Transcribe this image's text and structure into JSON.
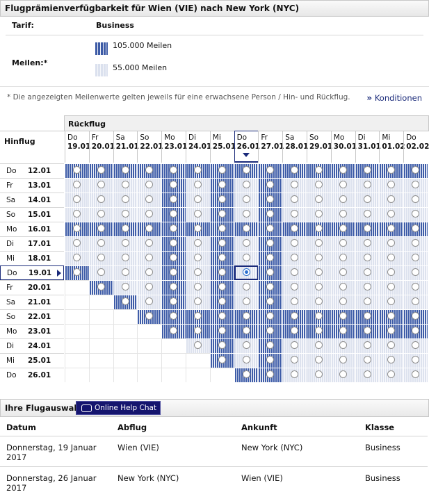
{
  "header": {
    "title": "Flugprämienverfügbarkeit für Wien (VIE) nach New York (NYC)"
  },
  "info": {
    "tarif_label": "Tarif:",
    "tarif_value": "Business",
    "meilen_label": "Meilen:*",
    "legend": [
      {
        "label": "105.000 Meilen",
        "color": "#3f5da8"
      },
      {
        "label": "55.000 Meilen",
        "color": "#dde2ee"
      }
    ],
    "note": "* Die angezeigten Meilenwerte gelten jeweils für eine erwachsene Person / Hin- und Rückflug.",
    "konditionen_arrow": "»",
    "konditionen": "Konditionen"
  },
  "calendar": {
    "rueckflug_label": "Rückflug",
    "hinflug_label": "Hinflug",
    "columns": [
      {
        "day": "Do",
        "date": "19.01"
      },
      {
        "day": "Fr",
        "date": "20.01"
      },
      {
        "day": "Sa",
        "date": "21.01"
      },
      {
        "day": "So",
        "date": "22.01"
      },
      {
        "day": "Mo",
        "date": "23.01"
      },
      {
        "day": "Di",
        "date": "24.01"
      },
      {
        "day": "Mi",
        "date": "25.01"
      },
      {
        "day": "Do",
        "date": "26.01"
      },
      {
        "day": "Fr",
        "date": "27.01"
      },
      {
        "day": "Sa",
        "date": "28.01"
      },
      {
        "day": "So",
        "date": "29.01"
      },
      {
        "day": "Mo",
        "date": "30.01"
      },
      {
        "day": "Di",
        "date": "31.01"
      },
      {
        "day": "Mi",
        "date": "01.02"
      },
      {
        "day": "Do",
        "date": "02.02"
      }
    ],
    "rows": [
      {
        "day": "Do",
        "date": "12.01"
      },
      {
        "day": "Fr",
        "date": "13.01"
      },
      {
        "day": "Sa",
        "date": "14.01"
      },
      {
        "day": "So",
        "date": "15.01"
      },
      {
        "day": "Mo",
        "date": "16.01"
      },
      {
        "day": "Di",
        "date": "17.01"
      },
      {
        "day": "Mi",
        "date": "18.01"
      },
      {
        "day": "Do",
        "date": "19.01"
      },
      {
        "day": "Fr",
        "date": "20.01"
      },
      {
        "day": "Sa",
        "date": "21.01"
      },
      {
        "day": "So",
        "date": "22.01"
      },
      {
        "day": "Mo",
        "date": "23.01"
      },
      {
        "day": "Di",
        "date": "24.01"
      },
      {
        "day": "Mi",
        "date": "25.01"
      },
      {
        "day": "Do",
        "date": "26.01"
      }
    ],
    "selected_row": 7,
    "selected_col": 7,
    "grid": [
      "DDDDDDDDDDDDDDD",
      "LLLLDLDLDLLLLLL",
      "LLLLDLDLDLLLLLL",
      "LLLLDLDLDLLLLLL",
      "DDDDDDDDDDDDDDD",
      "LLLLDLDLDLLLLLL",
      "LLLLDLDLDLLLLLL",
      "DLLLDLDLDLLLLLL",
      "-DLLDLDLDLLLLLL",
      "--DLDLDLDLLLLLL",
      "---DDDDDDDDDDDD",
      "----DDDDDDDDDDD",
      "-----LDLDLLLLLL",
      "------DLDLLLLLL",
      "-------DDLLLLLL"
    ]
  },
  "selection": {
    "title": "Ihre Flugauswahl",
    "chat_button": "Online Help Chat",
    "headers": {
      "datum": "Datum",
      "abflug": "Abflug",
      "ankunft": "Ankunft",
      "klasse": "Klasse"
    },
    "flights": [
      {
        "datum_1": "Donnerstag, 19 Januar",
        "datum_2": "2017",
        "abflug": "Wien (VIE)",
        "ankunft": "New York (NYC)",
        "klasse": "Business"
      },
      {
        "datum_1": "Donnerstag, 26 Januar",
        "datum_2": "2017",
        "abflug": "New York (NYC)",
        "ankunft": "Wien (VIE)",
        "klasse": "Business"
      }
    ]
  }
}
